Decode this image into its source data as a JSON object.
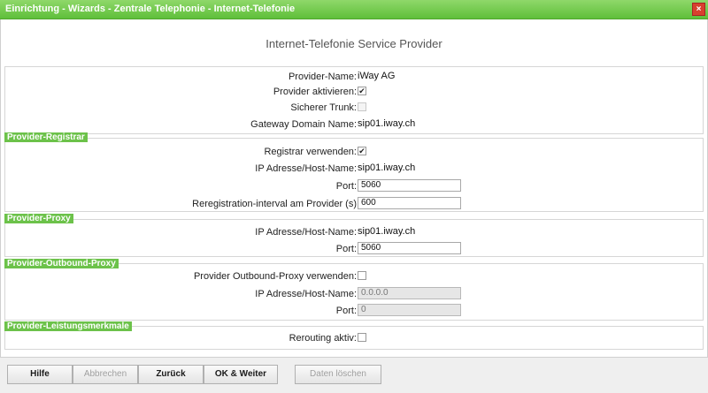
{
  "window": {
    "title": "Einrichtung - Wizards - Zentrale Telephonie - Internet-Telefonie",
    "close_glyph": "×"
  },
  "page": {
    "heading": "Internet-Telefonie Service Provider"
  },
  "provider": {
    "name_label": "Provider-Name:",
    "name_value": "iWay AG",
    "activate_label": "Provider aktivieren:",
    "activate_checked": true,
    "secure_label": "Sicherer Trunk:",
    "secure_checked": false,
    "gateway_label": "Gateway Domain Name:",
    "gateway_value": "sip01.iway.ch"
  },
  "registrar": {
    "section_title": "Provider-Registrar",
    "use_label": "Registrar verwenden:",
    "use_checked": true,
    "host_label": "IP Adresse/Host-Name:",
    "host_value": "sip01.iway.ch",
    "port_label": "Port:",
    "port_value": "5060",
    "interval_label": "Reregistration-interval am Provider (s)",
    "interval_value": "600"
  },
  "proxy": {
    "section_title": "Provider-Proxy",
    "host_label": "IP Adresse/Host-Name:",
    "host_value": "sip01.iway.ch",
    "port_label": "Port:",
    "port_value": "5060"
  },
  "outbound": {
    "section_title": "Provider-Outbound-Proxy",
    "use_label": "Provider Outbound-Proxy verwenden:",
    "use_checked": false,
    "host_label": "IP Adresse/Host-Name:",
    "host_value": "0.0.0.0",
    "port_label": "Port:",
    "port_value": "0"
  },
  "features": {
    "section_title": "Provider-Leistungsmerkmale",
    "rerouting_label": "Rerouting aktiv:",
    "rerouting_checked": false
  },
  "footer": {
    "help": "Hilfe",
    "cancel": "Abbrechen",
    "back": "Zurück",
    "ok_next": "OK & Weiter",
    "delete": "Daten löschen"
  },
  "icons": {
    "check_glyph": "✔"
  },
  "colors": {
    "accent": "#6cc24a",
    "title_bar": "#5fbf3a",
    "close": "#d8402e"
  }
}
